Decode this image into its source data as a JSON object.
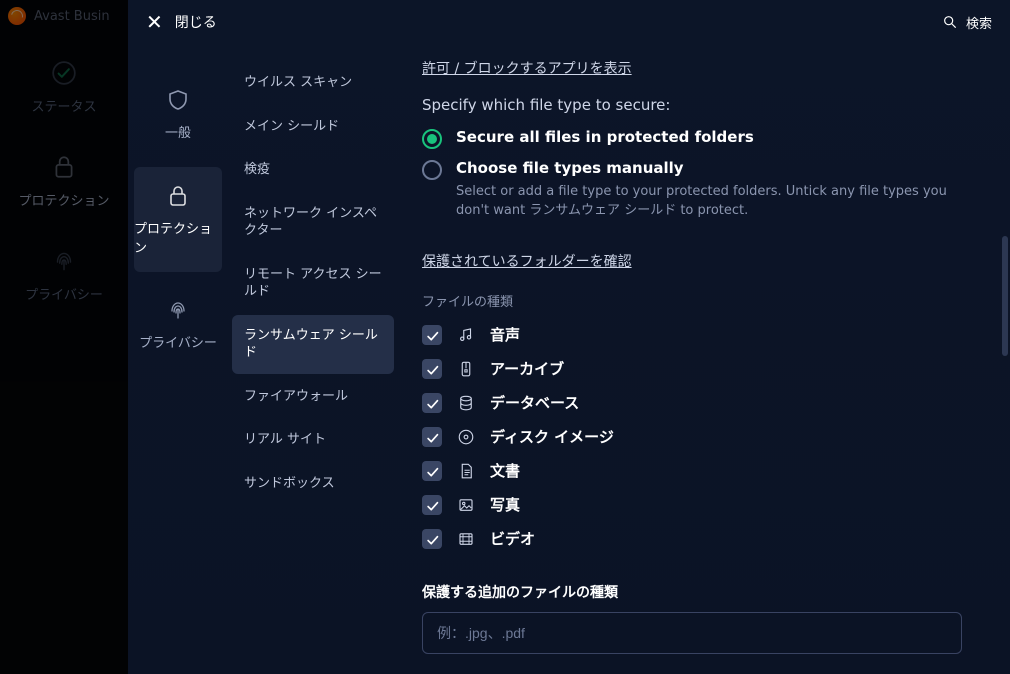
{
  "app": {
    "title": "Avast Busin"
  },
  "leftnav": {
    "items": [
      {
        "label": "ステータス",
        "icon": "status"
      },
      {
        "label": "プロテクション",
        "icon": "lock"
      },
      {
        "label": "プライバシー",
        "icon": "fingerprint"
      }
    ]
  },
  "overlay": {
    "close_label": "閉じる",
    "search_label": "検索"
  },
  "categories": {
    "items": [
      {
        "label": "一般",
        "icon": "shield"
      },
      {
        "label": "プロテクション",
        "icon": "lock"
      },
      {
        "label": "プライバシー",
        "icon": "fingerprint"
      }
    ],
    "active_index": 1
  },
  "submenu": {
    "items": [
      {
        "label": "ウイルス スキャン"
      },
      {
        "label": "メイン シールド"
      },
      {
        "label": "検疫"
      },
      {
        "label": "ネットワーク インスペクター"
      },
      {
        "label": "リモート アクセス シールド"
      },
      {
        "label": "ランサムウェア シールド"
      },
      {
        "label": "ファイアウォール"
      },
      {
        "label": "リアル サイト"
      },
      {
        "label": "サンドボックス"
      }
    ],
    "active_index": 5
  },
  "content": {
    "link_allow_block": "許可 / ブロックするアプリを表示",
    "specify_desc": "Specify which file type to secure:",
    "radio_secure_all": "Secure all files in protected folders",
    "radio_manual": "Choose file types manually",
    "radio_manual_help": "Select or add a file type to your protected folders. Untick any file types you don't want ランサムウェア シールド to protect.",
    "link_folders": "保護されているフォルダーを確認",
    "filetypes_title": "ファイルの種類",
    "filetypes": [
      {
        "label": "音声",
        "icon": "audio",
        "checked": true
      },
      {
        "label": "アーカイブ",
        "icon": "archive",
        "checked": true
      },
      {
        "label": "データベース",
        "icon": "database",
        "checked": true
      },
      {
        "label": "ディスク イメージ",
        "icon": "disc",
        "checked": true
      },
      {
        "label": "文書",
        "icon": "document",
        "checked": true
      },
      {
        "label": "写真",
        "icon": "photo",
        "checked": true
      },
      {
        "label": "ビデオ",
        "icon": "video",
        "checked": true
      }
    ],
    "additional_title": "保護する追加のファイルの種類",
    "additional_placeholder": "例：.jpg、.pdf"
  }
}
